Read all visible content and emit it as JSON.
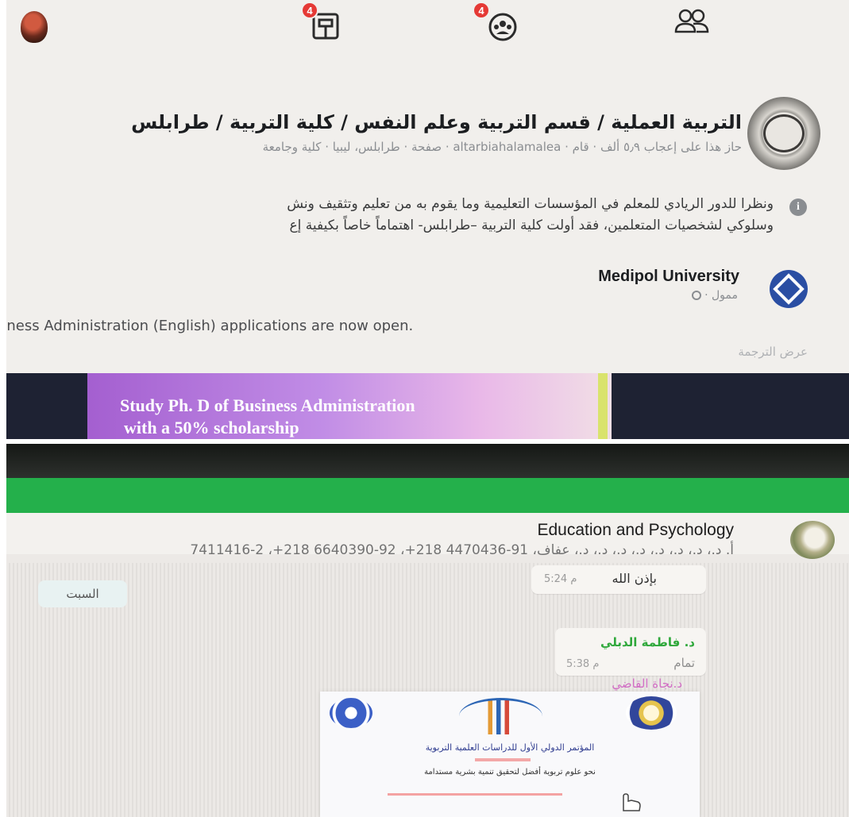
{
  "facebook": {
    "nav": {
      "groups_badge": "4",
      "community_badge": "4"
    },
    "page_result": {
      "title": "التربية العملية / قسم التربية وعلم النفس / كلية التربية / طرابلس",
      "meta": "صفحة · طرابلس، ليبيا · كلية وجامعة · altarbiahalamalea · حاز هذا على إعجاب ٥٫٩ ألف · قام",
      "description_line1": "ونظرا للدور الريادي للمعلم في المؤسسات التعليمية وما يقوم به من تعليم وتثقيف ونش",
      "description_line2": "وسلوكي لشخصيات المتعلمين، فقد أولت كلية التربية –طرابلس- اهتماماً خاصاً بكيفية إع"
    },
    "ad": {
      "advertiser": "Medipol University",
      "sponsored": "ممول ·",
      "text": "siness Administration (English) applications are now open.",
      "translate": "عرض الترجمة",
      "banner_line1": "Study Ph. D of Business Administration",
      "banner_line2": "with a 50% scholarship"
    }
  },
  "whatsapp": {
    "group_name": "Education and Psychology",
    "members": "أ. د.، د.، د.، د.، د.، د.، د.، د.، عفاف، 91-4470436 218+، 92-6640390 218+، 2-7411416",
    "day_label": "السبت",
    "messages": [
      {
        "text": "بإذن الله",
        "time": "5:24 م"
      },
      {
        "sender": "د. فاطمة الدبلي",
        "text": "تمام",
        "time": "5:38 م"
      }
    ],
    "third_sender": "د.نجاة القاضي",
    "poster": {
      "title": "المؤتمر الدولي الأول للدراسات العلمية التربوية",
      "subtitle": "نحو علوم تربوية أفضل لتحقيق تنمية بشرية مستدامة"
    }
  }
}
